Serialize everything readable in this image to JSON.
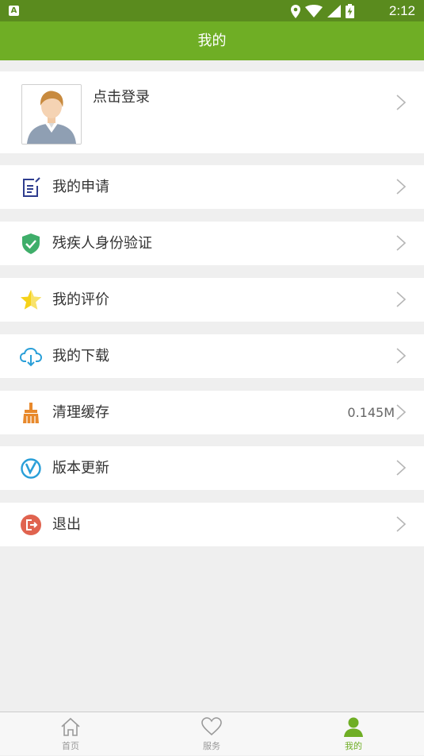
{
  "status_bar": {
    "app_badge": "A",
    "time": "2:12"
  },
  "header": {
    "title": "我的"
  },
  "profile": {
    "login_label": "点击登录"
  },
  "menu": [
    {
      "id": "applications",
      "label": "我的申请",
      "icon": "document-edit-icon"
    },
    {
      "id": "identity",
      "label": "残疾人身份验证",
      "icon": "shield-check-icon"
    },
    {
      "id": "reviews",
      "label": "我的评价",
      "icon": "star-icon"
    },
    {
      "id": "downloads",
      "label": "我的下载",
      "icon": "cloud-download-icon"
    },
    {
      "id": "cache",
      "label": "清理缓存",
      "icon": "broom-icon",
      "value": "0.145M"
    },
    {
      "id": "update",
      "label": "版本更新",
      "icon": "version-v-icon"
    },
    {
      "id": "logout",
      "label": "退出",
      "icon": "logout-icon"
    }
  ],
  "tabs": [
    {
      "label": "首页",
      "icon": "home-icon",
      "active": false
    },
    {
      "label": "服务",
      "icon": "heart-icon",
      "active": false
    },
    {
      "label": "我的",
      "icon": "person-icon",
      "active": true
    }
  ],
  "colors": {
    "accent": "#6fae25",
    "status_bar": "#5a8b1e"
  }
}
